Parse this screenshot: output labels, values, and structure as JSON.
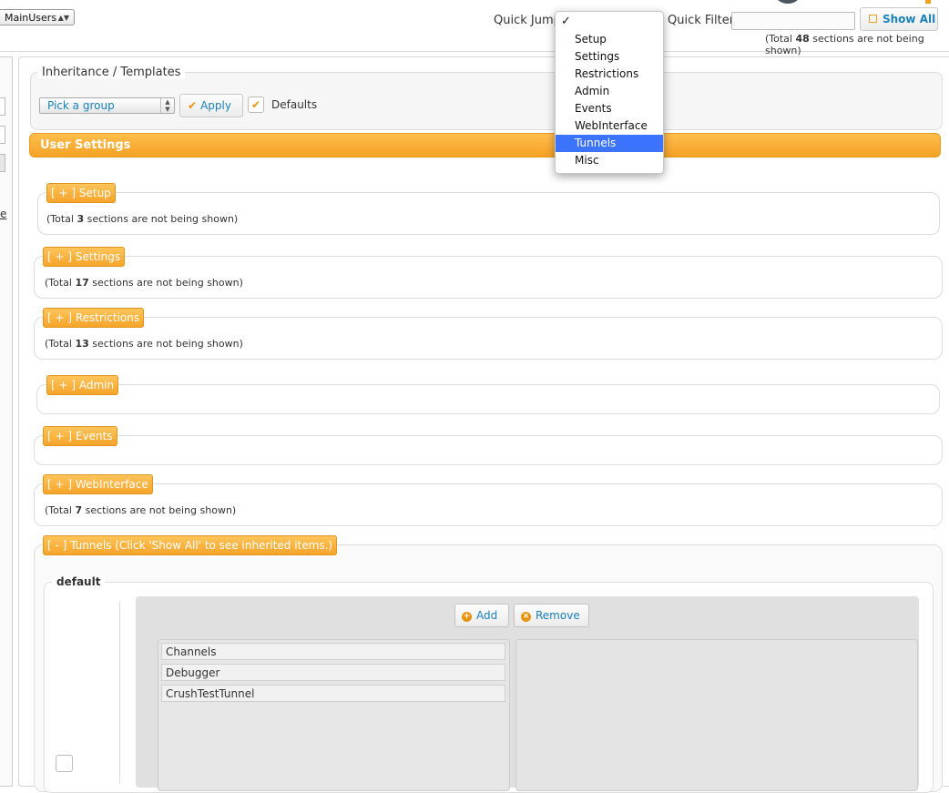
{
  "topbar": {
    "user_select": "MainUsers",
    "quick_jump_label": "Quick Jump",
    "quick_filter_label": "Quick Filter",
    "quick_filter_value": "",
    "show_all_label": "Show All",
    "hidden_prefix": "(Total ",
    "hidden_count": "48",
    "hidden_suffix": " sections are not being shown)"
  },
  "left_panel": {
    "link_fragment": "e"
  },
  "inheritance": {
    "legend": "Inheritance / Templates",
    "group_select": "Pick a group",
    "apply_label": "Apply",
    "defaults_label": "Defaults",
    "defaults_checked": true
  },
  "user_settings_title": "User Settings",
  "sections": [
    {
      "header": "[ + ] Setup",
      "prefix": "(Total ",
      "count": "3",
      "suffix": " sections are not being shown)"
    },
    {
      "header": "[ + ] Settings",
      "prefix": "(Total ",
      "count": "17",
      "suffix": " sections are not being shown)"
    },
    {
      "header": "[ + ] Restrictions",
      "prefix": "(Total ",
      "count": "13",
      "suffix": " sections are not being shown)"
    },
    {
      "header": "[ + ] Admin"
    },
    {
      "header": "[ + ] Events"
    },
    {
      "header": "[ + ] WebInterface",
      "prefix": "(Total ",
      "count": "7",
      "suffix": " sections are not being shown)"
    }
  ],
  "tunnels": {
    "header": "[ - ] Tunnels (Click 'Show All' to see inherited items.)",
    "default_legend": "default",
    "add_label": "Add",
    "remove_label": "Remove",
    "available": [
      "Channels",
      "Debugger",
      "CrushTestTunnel"
    ]
  },
  "quick_jump_menu": {
    "check_mark": "✓",
    "items": [
      "Setup",
      "Settings",
      "Restrictions",
      "Admin",
      "Events",
      "WebInterface",
      "Tunnels",
      "Misc"
    ],
    "highlighted": "Tunnels"
  },
  "colors": {
    "accent_orange": "#f5a126",
    "link_blue": "#1a82b9",
    "menu_highlight": "#3c74ff"
  }
}
